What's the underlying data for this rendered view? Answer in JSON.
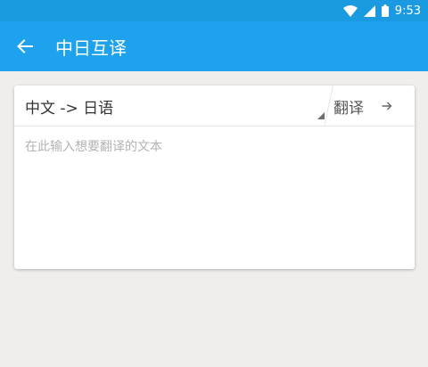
{
  "status_bar": {
    "time": "9:53"
  },
  "app_bar": {
    "title": "中日互译",
    "back_icon": "arrow-left-icon"
  },
  "card": {
    "language_pair": "中文 -> 日语",
    "translate_label": "翻译",
    "input": {
      "value": "",
      "placeholder": "在此输入想要翻译的文本"
    }
  },
  "colors": {
    "status_bar": "#1a9ae0",
    "app_bar": "#1ea2ee",
    "background": "#efeeec"
  }
}
